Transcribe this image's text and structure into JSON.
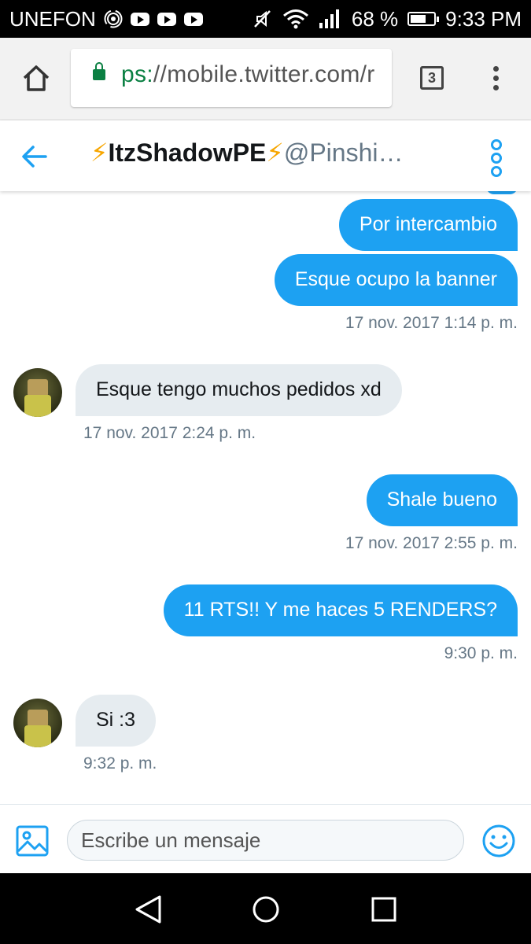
{
  "status_bar": {
    "carrier": "UNEFON",
    "battery": "68 %",
    "battery_level": 0.68,
    "time": "9:33 PM"
  },
  "browser": {
    "url_scheme": "ps:",
    "url_rest": "//mobile.twitter.com/r",
    "tab_count": "3"
  },
  "conversation": {
    "bolt": "⚡",
    "name": "ItzShadowPE",
    "handle": "@Pinshi…"
  },
  "messages": [
    {
      "direction": "sent",
      "text": "Por intercambio"
    },
    {
      "direction": "sent",
      "text": "Esque ocupo la banner",
      "time": "17 nov. 2017 1:14 p. m."
    },
    {
      "direction": "received",
      "text": "Esque tengo muchos pedidos xd",
      "time": "17 nov. 2017 2:24 p. m."
    },
    {
      "direction": "sent",
      "text": "Shale bueno",
      "time": "17 nov. 2017 2:55 p. m."
    },
    {
      "direction": "sent",
      "text": "11 RTS!! Y me haces 5 RENDERS?",
      "time": "9:30 p. m."
    },
    {
      "direction": "received",
      "text": "Si :3",
      "time": "9:32 p. m."
    }
  ],
  "compose": {
    "placeholder": "Escribe un mensaje"
  },
  "colors": {
    "accent": "#1da1f2",
    "received_bubble": "#e6ecf0",
    "meta_text": "#657786",
    "lock_green": "#0b8043",
    "bolt": "#f7a600"
  },
  "icons": [
    "home-icon",
    "lock-icon",
    "tabs-icon",
    "overflow-menu-icon",
    "back-arrow-icon",
    "more-options-icon",
    "image-icon",
    "emoji-icon",
    "nav-back-icon",
    "nav-home-icon",
    "nav-recents-icon"
  ]
}
